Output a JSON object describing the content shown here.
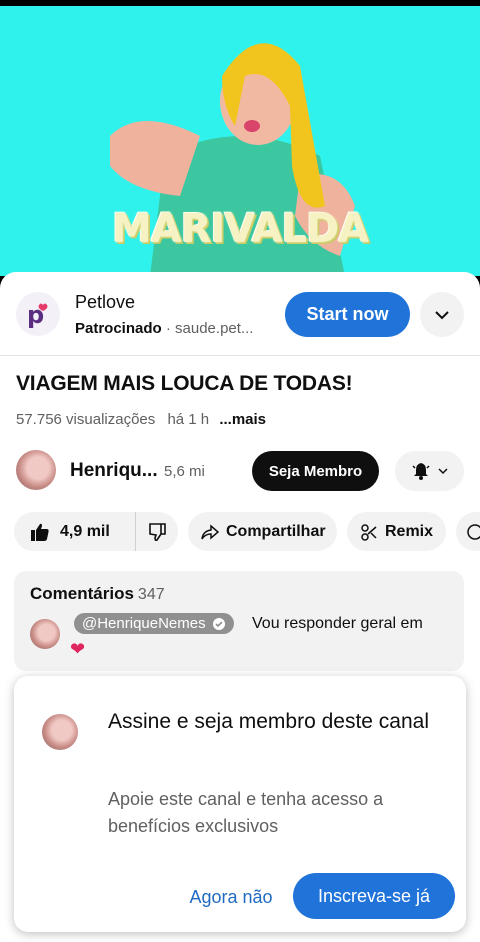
{
  "video": {
    "overlay_text": "MARIVALDA"
  },
  "ad": {
    "advertiser": "Petlove",
    "sponsored_label": "Patrocinado",
    "separator": "·",
    "domain": "saude.pet...",
    "cta": "Start now",
    "logo_letter": "p"
  },
  "video_info": {
    "title": "VIAGEM MAIS LOUCA DE TODAS!",
    "views": "57.756 visualizações",
    "age": "há 1 h",
    "more": "...mais"
  },
  "channel": {
    "name": "Henriqu...",
    "subscribers": "5,6 mi",
    "member_button": "Seja Membro"
  },
  "actions": {
    "likes": "4,9 mil",
    "share": "Compartilhar",
    "remix": "Remix"
  },
  "comments": {
    "title": "Comentários",
    "count": "347",
    "author": "@HenriqueNemes",
    "text": "Vou responder geral em",
    "emoji": "❤"
  },
  "membership_sheet": {
    "title": "Assine e seja membro deste canal",
    "description": "Apoie este canal e tenha acesso a benefícios exclusivos",
    "dismiss": "Agora não",
    "join": "Inscreva-se já"
  },
  "colors": {
    "accent": "#1f73d9",
    "video_bg": "#2ff2ec",
    "dark_button": "#0f0f0f"
  }
}
